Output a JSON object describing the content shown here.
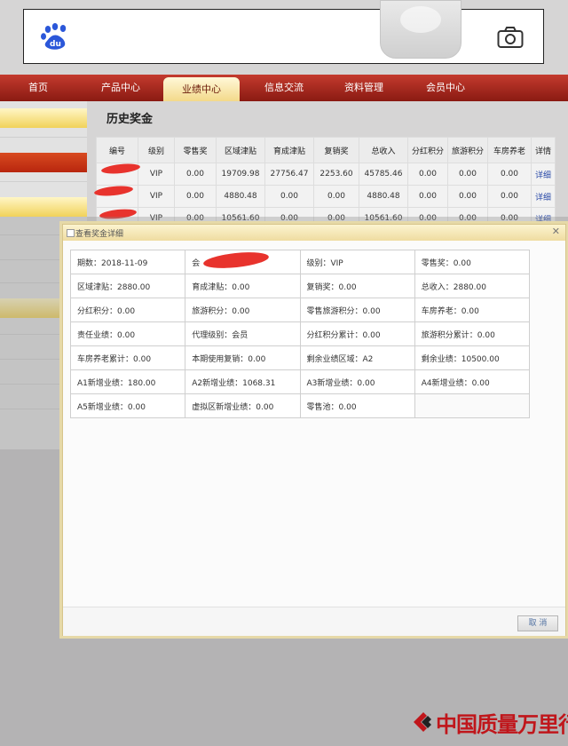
{
  "nav": {
    "items": [
      "首页",
      "产品中心",
      "业绩中心",
      "信息交流",
      "资料管理",
      "会员中心"
    ],
    "active_index": 2
  },
  "history": {
    "title": "历史奖金",
    "columns": [
      "编号",
      "级别",
      "零售奖",
      "区域津贴",
      "育成津贴",
      "复销奖",
      "总收入",
      "分红积分",
      "旅游积分",
      "车房养老",
      "详情"
    ],
    "rows": [
      [
        "",
        "VIP",
        "0.00",
        "19709.98",
        "27756.47",
        "2253.60",
        "45785.46",
        "0.00",
        "0.00",
        "0.00",
        "详细"
      ],
      [
        "",
        "VIP",
        "0.00",
        "4880.48",
        "0.00",
        "0.00",
        "4880.48",
        "0.00",
        "0.00",
        "0.00",
        "详细"
      ],
      [
        "",
        "VIP",
        "0.00",
        "10561.60",
        "0.00",
        "0.00",
        "10561.60",
        "0.00",
        "0.00",
        "0.00",
        "详细"
      ]
    ]
  },
  "dialog": {
    "title": "查看奖金详细",
    "cells": [
      [
        "期数：2018-11-09",
        "会",
        "级别：VIP",
        "零售奖：0.00"
      ],
      [
        "区域津贴：2880.00",
        "育成津贴：0.00",
        "复销奖：0.00",
        "总收入：2880.00"
      ],
      [
        "分红积分：0.00",
        "旅游积分：0.00",
        "零售旅游积分：0.00",
        "车房养老：0.00"
      ],
      [
        "责任业绩：0.00",
        "代理级别：会员",
        "分红积分累计：0.00",
        "旅游积分累计：0.00"
      ],
      [
        "车房养老累计：0.00",
        "本期使用复销：0.00",
        "剩余业绩区域：A2",
        "剩余业绩：10500.00"
      ],
      [
        "A1新增业绩：180.00",
        "A2新增业绩：1068.31",
        "A3新增业绩：0.00",
        "A4新增业绩：0.00"
      ],
      [
        "A5新增业绩：0.00",
        "虚拟区新增业绩：0.00",
        "零售池：0.00",
        ""
      ]
    ],
    "cancel_label": "取 消"
  },
  "watermark": {
    "text": "中国质量万里行"
  },
  "colors": {
    "nav_red": "#a3281c",
    "scribble_red": "#e8332d",
    "link_blue": "#2a4aa8",
    "watermark_red": "#c0161b"
  }
}
